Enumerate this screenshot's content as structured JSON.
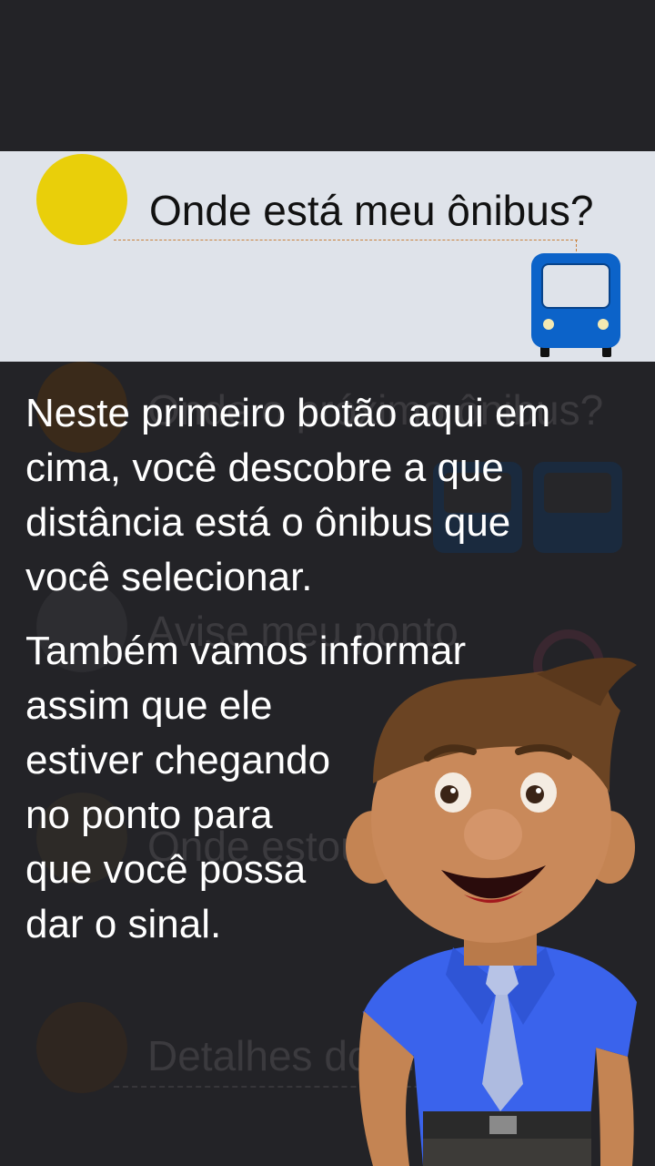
{
  "highlighted_item": {
    "label": "Onde está meu ônibus?",
    "icon": "bus-icon",
    "circle_color": "#e9cf0a"
  },
  "background_menu": {
    "items": [
      {
        "label": "Onde o próximo ônibus?"
      },
      {
        "label": "Avise meu ponto"
      },
      {
        "label": "Onde estou?"
      },
      {
        "label": "Detalhes do ônibus"
      }
    ]
  },
  "tutorial": {
    "paragraph1_lines": [
      "Neste primeiro botão aqui em",
      "cima, você descobre a que",
      "distância está o ônibus que",
      "você selecionar."
    ],
    "paragraph2_lines": [
      "Também vamos informar",
      "assim que ele",
      "estiver chegando",
      "no ponto para",
      "que você possa",
      "dar o sinal."
    ]
  },
  "colors": {
    "overlay": "#232327",
    "highlight_bg": "#dfe3ea",
    "bus_blue": "#0c63c9"
  }
}
